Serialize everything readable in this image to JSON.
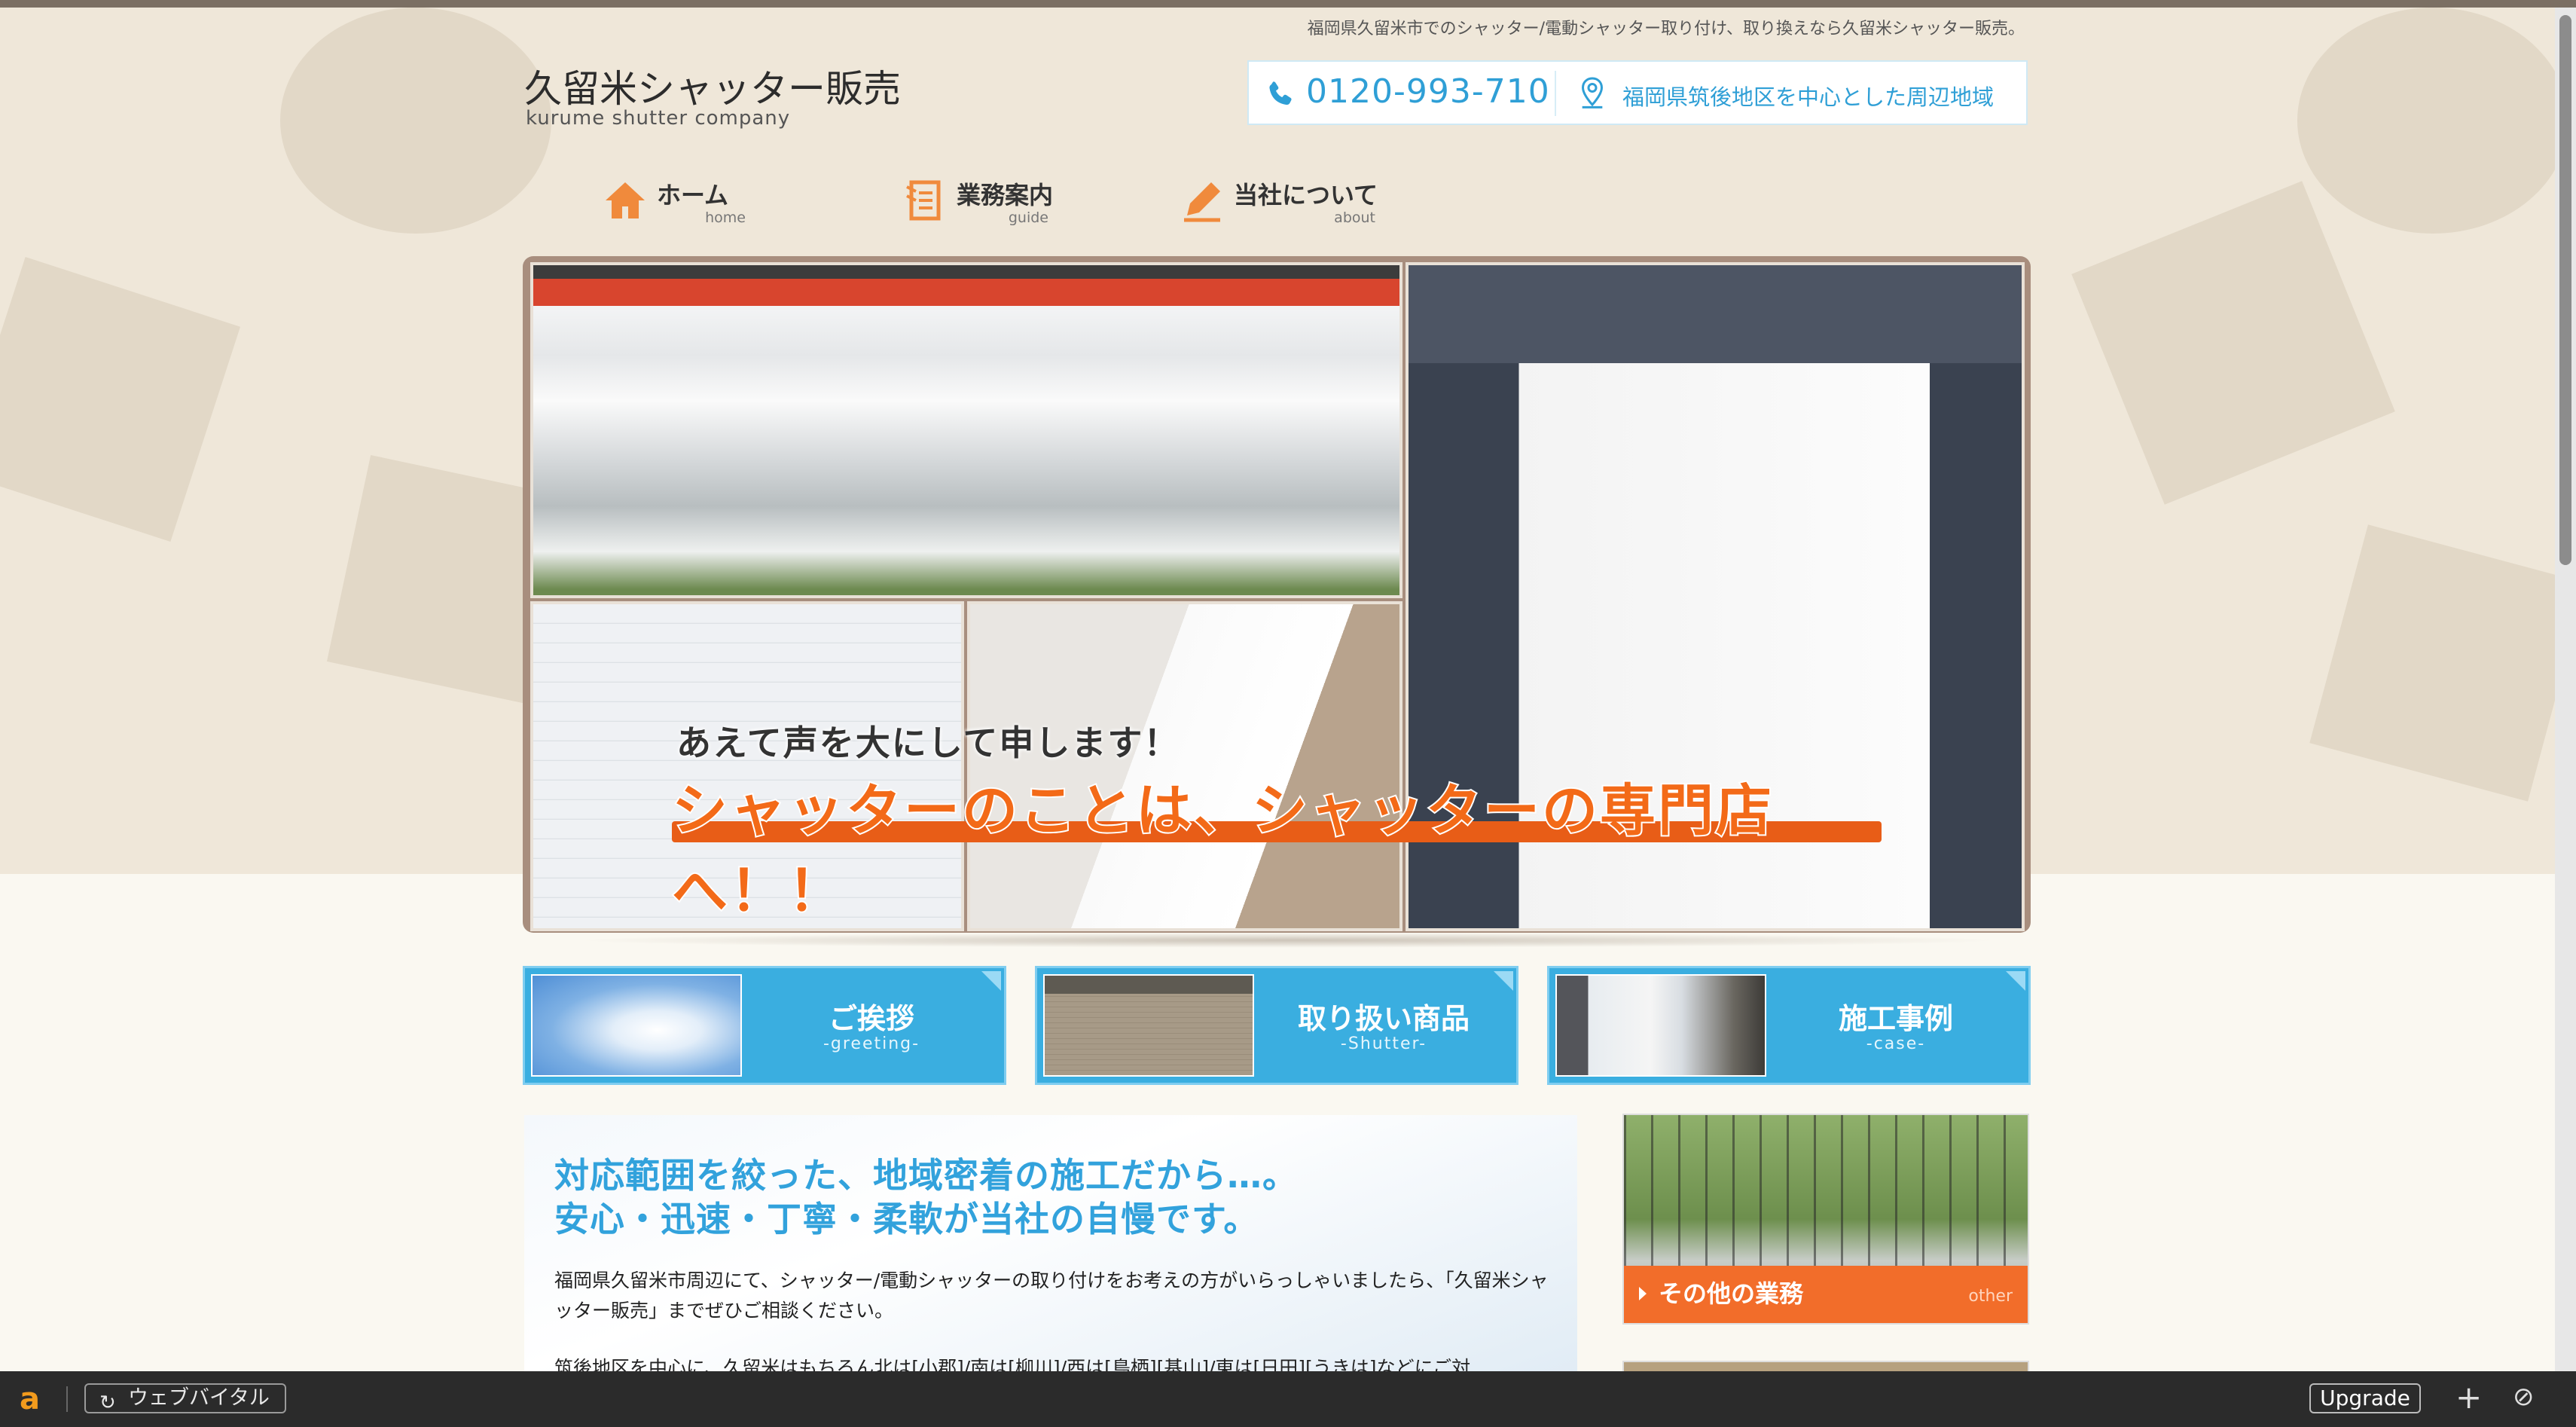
{
  "header": {
    "tagline": "福岡県久留米市でのシャッター/電動シャッター取り付け、取り換えなら久留米シャッター販売。",
    "logo_ja": "久留米シャッター販売",
    "logo_en": "kurume shutter company",
    "phone": "0120-993-710",
    "service_area": "福岡県筑後地区を中心とした周辺地域"
  },
  "nav": [
    {
      "label": "ホーム",
      "sub": "home",
      "icon": "house-icon"
    },
    {
      "label": "業務案内",
      "sub": "guide",
      "icon": "document-icon"
    },
    {
      "label": "当社について",
      "sub": "about",
      "icon": "pencil-icon"
    }
  ],
  "hero": {
    "line1": "あえて声を大にして申します！",
    "line2": "シャッターのことは、シャッターの専門店へ！！"
  },
  "cards": [
    {
      "title": "ご挨拶",
      "sub": "-greeting-"
    },
    {
      "title": "取り扱い商品",
      "sub": "-Shutter-"
    },
    {
      "title": "施工事例",
      "sub": "-case-"
    }
  ],
  "main": {
    "heading_line1": "対応範囲を絞った、地域密着の施工だから…。",
    "heading_line2": "安心・迅速・丁寧・柔軟が当社の自慢です。",
    "paragraph1": "福岡県久留米市周辺にて、シャッター/電動シャッターの取り付けをお考えの方がいらっしゃいましたら、「久留米シャッター販売」までぜひご相談ください。",
    "paragraph2": "筑後地区を中心に、久留米はもちろん北は[小郡]/南は[柳川]/西は[鳥栖][基山]/東は[日田][うきは]などにご対"
  },
  "sidebar": {
    "other_title": "その他の業務",
    "other_sub": "other"
  },
  "bottom_bar": {
    "logo": "a",
    "vitals": "ウェブバイタル",
    "upgrade": "Upgrade",
    "plus": "+",
    "block": "⊘"
  },
  "colors": {
    "accent_blue": "#3aaee0",
    "accent_orange": "#f36a18",
    "bottom_bar": "#2b2b2b"
  }
}
